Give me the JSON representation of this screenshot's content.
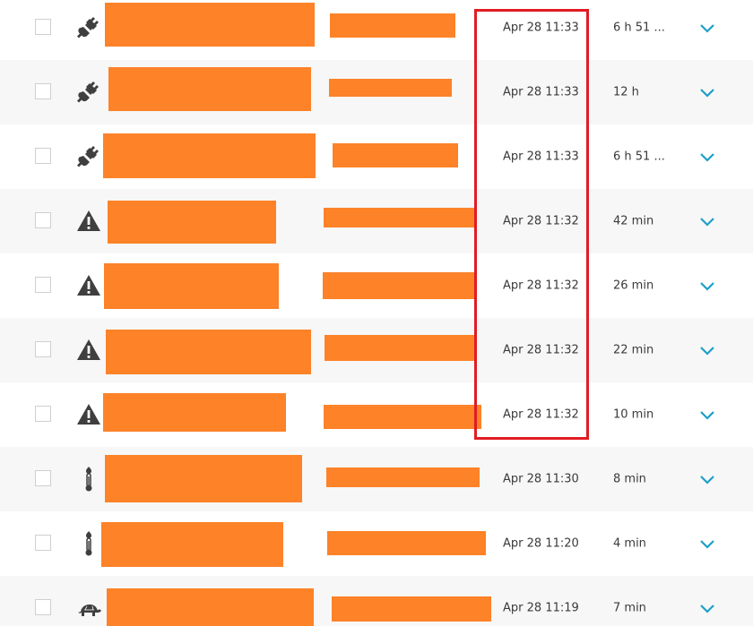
{
  "colors": {
    "redaction": "#fd8228",
    "highlight": "#e21b23",
    "chevron": "#1ba0c8",
    "icon": "#3f3f3f"
  },
  "rows": [
    {
      "icon": "plug-icon",
      "time": "Apr 28 11:33",
      "duration": "6 h 51 ..."
    },
    {
      "icon": "plug-icon",
      "time": "Apr 28 11:33",
      "duration": "12 h"
    },
    {
      "icon": "plug-icon",
      "time": "Apr 28 11:33",
      "duration": "6 h 51 ..."
    },
    {
      "icon": "warning-icon",
      "time": "Apr 28 11:32",
      "duration": "42 min"
    },
    {
      "icon": "warning-icon",
      "time": "Apr 28 11:32",
      "duration": "26 min"
    },
    {
      "icon": "warning-icon",
      "time": "Apr 28 11:32",
      "duration": "22 min"
    },
    {
      "icon": "warning-icon",
      "time": "Apr 28 11:32",
      "duration": "10 min"
    },
    {
      "icon": "thermometer-icon",
      "time": "Apr 28 11:30",
      "duration": "8 min"
    },
    {
      "icon": "thermometer-icon",
      "time": "Apr 28 11:20",
      "duration": "4 min"
    },
    {
      "icon": "turtle-icon",
      "time": "Apr 28 11:19",
      "duration": "7 min"
    }
  ]
}
